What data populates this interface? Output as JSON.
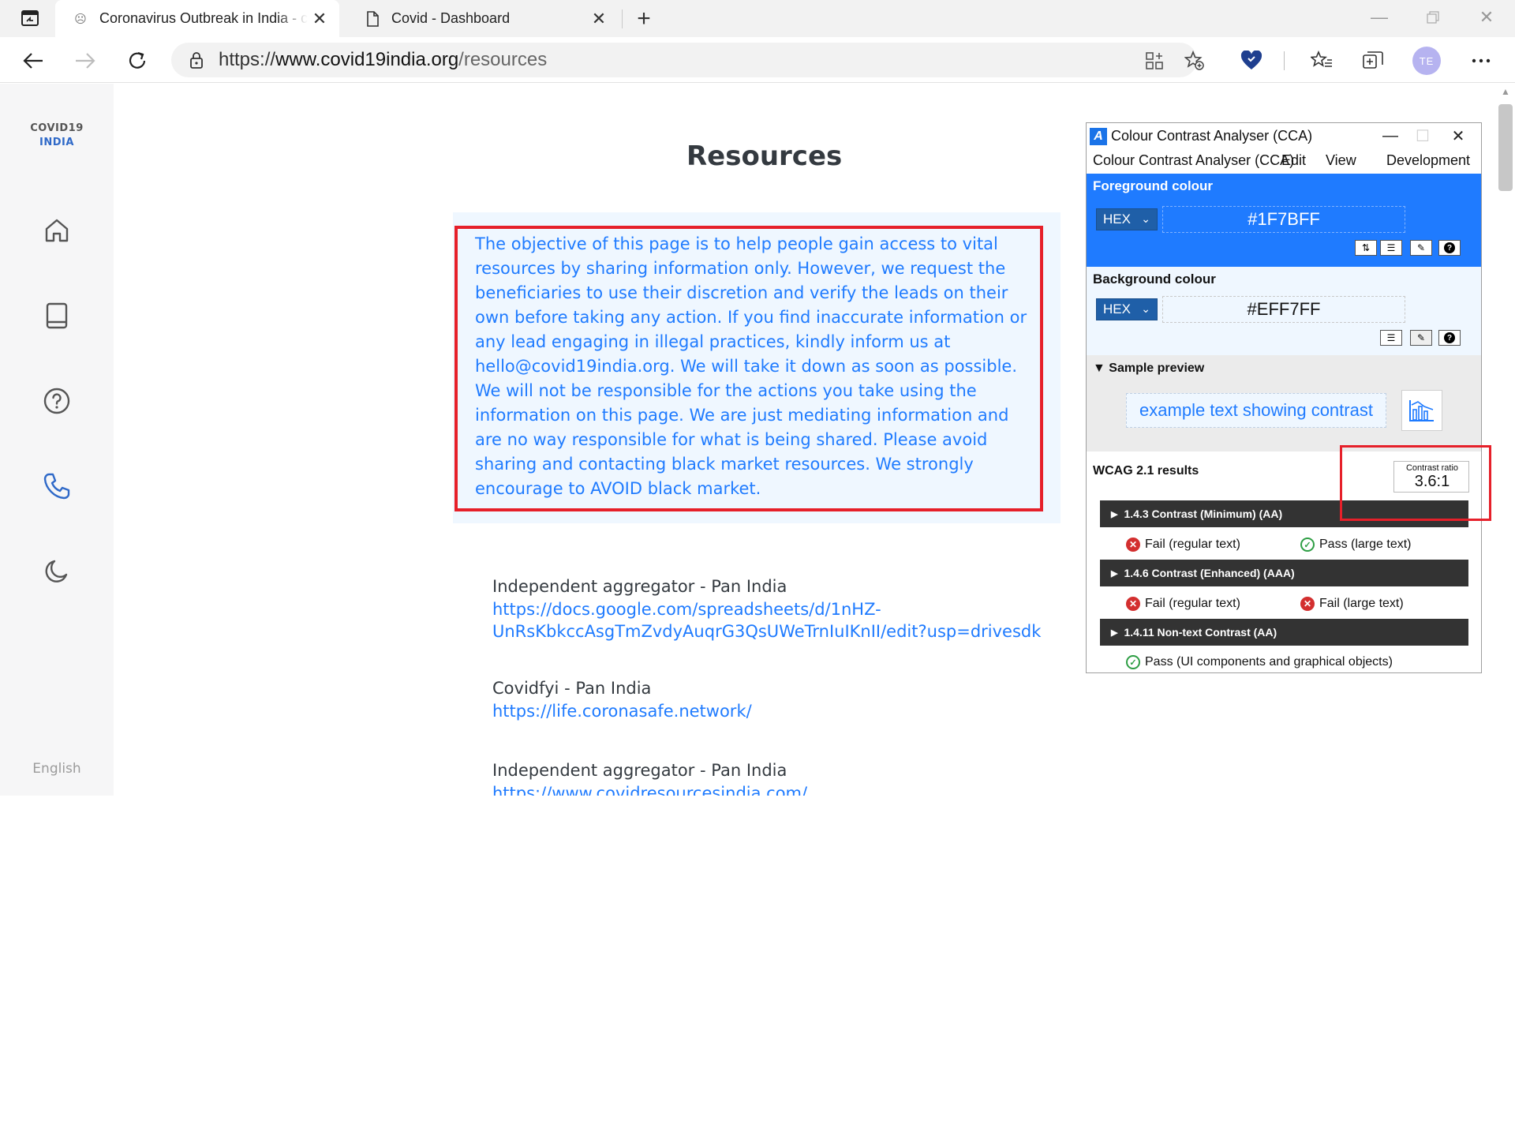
{
  "browser": {
    "tabs": [
      {
        "title": "Coronavirus Outbreak in India - c",
        "favicon": "smiley-icon"
      },
      {
        "title": "Covid - Dashboard",
        "favicon": "page-icon"
      }
    ],
    "url": {
      "scheme": "https://",
      "host": "www.covid19india.org",
      "path": "/resources"
    },
    "avatar_initials": "TE"
  },
  "sidebar": {
    "brand_line1": "COVID19",
    "brand_line2": "INDIA",
    "items": [
      {
        "icon": "home-icon"
      },
      {
        "icon": "book-icon"
      },
      {
        "icon": "help-circle-icon"
      },
      {
        "icon": "phone-icon",
        "active": true
      },
      {
        "icon": "moon-icon"
      }
    ],
    "language": "English"
  },
  "page": {
    "title": "Resources",
    "disclaimer": "The objective of this page is to help people gain access to vital resources by sharing information only. However, we request the beneficiaries to use their discretion and verify the leads on their own before taking any action. If you find inaccurate information or any lead engaging in illegal practices, kindly inform us at hello@covid19india.org. We will take it down as soon as possible. We will not be responsible for the actions you take using the information on this page. We are just mediating information and are no way responsible for what is being shared. Please avoid sharing and contacting black market resources. We strongly encourage to AVOID black market.",
    "resources": [
      {
        "name": "Independent aggregator - Pan India",
        "link_line1": "https://docs.google.com/spreadsheets/d/1nHZ-",
        "link_line2": "UnRsKbkccAsgTmZvdyAuqrG3QsUWeTrnIuIKnII/edit?usp=drivesdk"
      },
      {
        "name": "Covidfyi - Pan India",
        "link_line1": "https://life.coronasafe.network/",
        "link_line2": ""
      },
      {
        "name": "Independent aggregator - Pan India",
        "link_line1": "https://www.covidresourcesindia.com/",
        "link_line2": ""
      }
    ]
  },
  "cca": {
    "title": "Colour Contrast Analyser (CCA)",
    "menu": [
      "Colour Contrast Analyser (CCA)",
      "Edit",
      "View",
      "Development"
    ],
    "foreground": {
      "label": "Foreground colour",
      "format": "HEX",
      "value": "#1F7BFF"
    },
    "background": {
      "label": "Background colour",
      "format": "HEX",
      "value": "#EFF7FF"
    },
    "preview": {
      "label": "Sample preview",
      "sample": "example text showing contrast"
    },
    "wcag": {
      "label": "WCAG 2.1 results",
      "ratio_label": "Contrast ratio",
      "ratio_value": "3.6:1",
      "criteria": [
        {
          "name": "1.4.3 Contrast (Minimum) (AA)",
          "results": [
            {
              "text": "Fail (regular text)",
              "status": "fail"
            },
            {
              "text": "Pass (large text)",
              "status": "pass"
            }
          ]
        },
        {
          "name": "1.4.6 Contrast (Enhanced) (AAA)",
          "results": [
            {
              "text": "Fail (regular text)",
              "status": "fail"
            },
            {
              "text": "Fail (large text)",
              "status": "fail"
            }
          ]
        },
        {
          "name": "1.4.11 Non-text Contrast (AA)",
          "results": [
            {
              "text": "Pass (UI components and graphical objects)",
              "status": "pass"
            }
          ]
        }
      ]
    }
  },
  "colors": {
    "accent_blue": "#1F7BFF",
    "light_blue_bg": "#EFF7FF",
    "annotation_red": "#E6202A",
    "fail_red": "#D32F2F",
    "pass_green": "#2E9E44"
  }
}
